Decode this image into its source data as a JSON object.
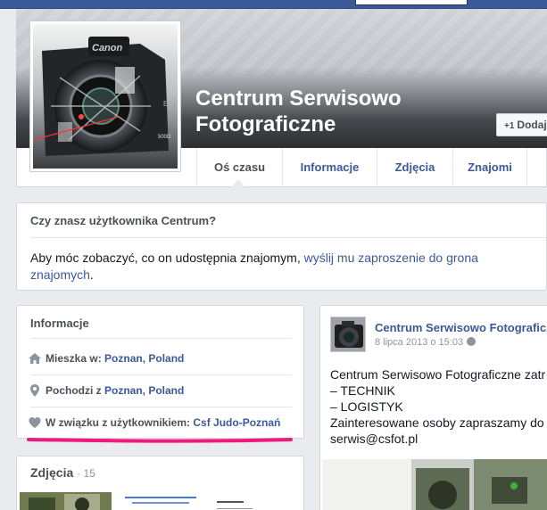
{
  "profile": {
    "name_line1": "Centrum Serwisowo",
    "name_line2": "Fotograficzne",
    "add_friend_label": "Dodaj"
  },
  "tabs": [
    {
      "label": "Oś czasu",
      "active": true
    },
    {
      "label": "Informacje",
      "active": false
    },
    {
      "label": "Zdjęcia",
      "active": false
    },
    {
      "label": "Znajomi",
      "active": false
    }
  ],
  "invite": {
    "title": "Czy znasz użytkownika Centrum?",
    "text_prefix": "Aby móc zobaczyć, co on udostępnia znajomym, ",
    "link_text": "wyślij mu zaproszenie do grona znajomych",
    "text_suffix": "."
  },
  "info": {
    "title": "Informacje",
    "lives_label": "Mieszka w: ",
    "lives_value": "Poznan, Poland",
    "from_label": "Pochodzi z ",
    "from_value": "Poznan, Poland",
    "relationship_label": "W związku z użytkownikiem: ",
    "relationship_value": "Csf Judo-Poznań"
  },
  "photos": {
    "title": "Zdjęcia",
    "count": "· 15"
  },
  "post": {
    "author": "Centrum Serwisowo Fotograficzne",
    "date": "8 lipca 2013 o 15:03",
    "lines": [
      "Centrum Serwisowo Fotograficzne zatr",
      "– TECHNIK",
      "– LOGISTYK",
      "Zainteresowane osoby zapraszamy do",
      "serwis@csfot.pl"
    ]
  },
  "colors": {
    "brand_blue": "#3b5998",
    "highlight_pink": "#f0197c"
  },
  "icons": {
    "add_friend": "add-friend-icon",
    "lives": "home-icon",
    "from": "location-pin-icon",
    "relationship": "heart-icon",
    "privacy": "globe-icon"
  }
}
